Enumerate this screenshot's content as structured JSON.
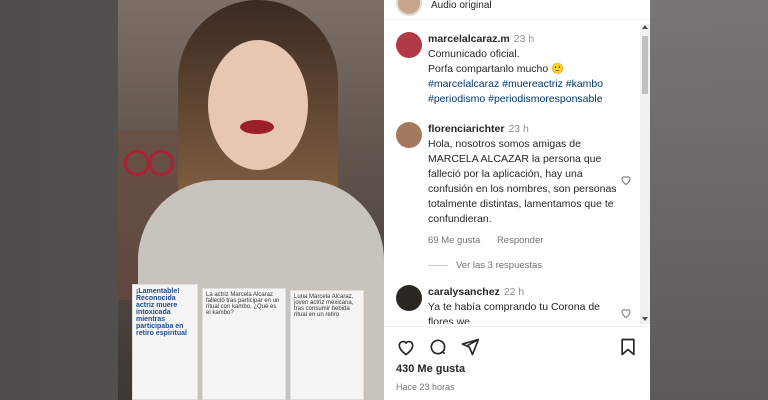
{
  "post": {
    "audio_label": "Audio original"
  },
  "comments": [
    {
      "user": "marcelalcaraz.m",
      "time": "23 h",
      "lines": [
        "Comunicado oficial.",
        "Porfa compartanlo mucho 🙂"
      ],
      "tags": [
        "#marcelalcaraz",
        "#muereactriz",
        "#kambo",
        "#periodismo",
        "#periodismoresponsable"
      ]
    },
    {
      "user": "florenciarichter",
      "time": "23 h",
      "text": "Hola, nosotros somos amigas de MARCELA ALCAZAR la persona que falleció por la aplicación, hay una confusión en los nombres, son personas totalmente distintas, lamentamos que te confundieran.",
      "likes": "69 Me gusta",
      "reply_label": "Responder",
      "view_replies": "Ver las 3 respuestas"
    },
    {
      "user": "caralysanchez",
      "time": "22 h",
      "text": "Ya te había comprando tu Corona de flores we"
    }
  ],
  "footer": {
    "likes": "430 Me gusta",
    "ago": "Hace 23 horas"
  },
  "media": {
    "doc1_headline": "¡Lamentable! Reconocida actriz muere intoxicada mientras participaba en retiro espiritual",
    "doc2_headline": "La actriz Marcela Alcaraz falleció tras participar en un ritual con kambo. ¿Qué es el kambo?",
    "doc3_headline": "Luna Marcela Alcaraz, joven actriz mexicana, tras consumir bebida ritual en un retiro"
  },
  "icons": [
    "heart-icon",
    "comment-icon",
    "share-icon",
    "bookmark-icon"
  ],
  "colors": {
    "tag": "#00376b",
    "muted": "#737373",
    "text": "#262626"
  }
}
